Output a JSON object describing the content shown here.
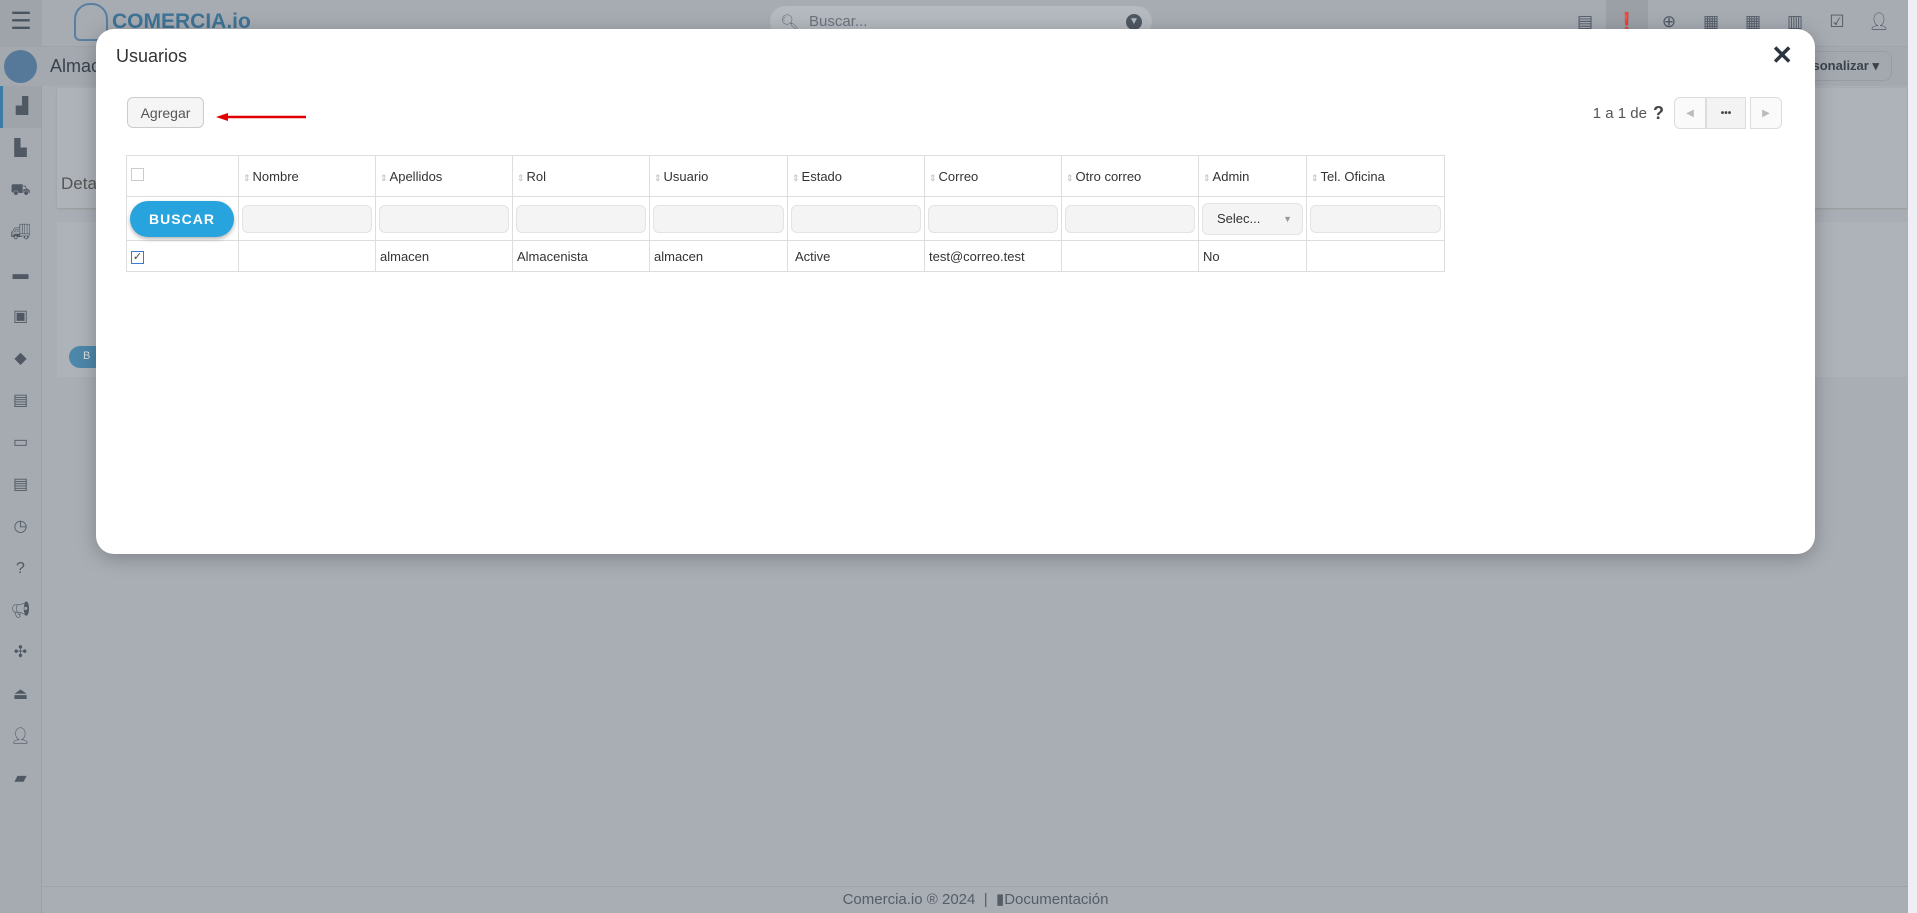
{
  "app": {
    "logo": "COMERCIA.io",
    "search_placeholder": "Buscar...",
    "page_title": "Almac",
    "personalize": "Personalizar",
    "bg_tab": "Deta",
    "bg_btn": "B"
  },
  "modal": {
    "title": "Usuarios",
    "add_label": "Agregar",
    "pager_text": "1 a 1  de",
    "pager_help": "?",
    "pager_dots": "•••",
    "search_button": "BUSCAR",
    "admin_select": "Selec...",
    "columns": [
      "Nombre",
      "Apellidos",
      "Rol",
      "Usuario",
      "Estado",
      "Correo",
      "Otro correo",
      "Admin",
      "Tel. Oficina"
    ],
    "rows": [
      {
        "checked": true,
        "cells": [
          "",
          "almacen",
          "Almacenista",
          "almacen",
          "Active",
          "test@correo.test",
          "",
          "No",
          ""
        ]
      }
    ]
  },
  "footer": {
    "copyright": "Comercia.io ® 2024",
    "separator": "|",
    "docs": "Documentación"
  },
  "colors": {
    "accent": "#27a3dd",
    "arrow": "#e00000"
  }
}
